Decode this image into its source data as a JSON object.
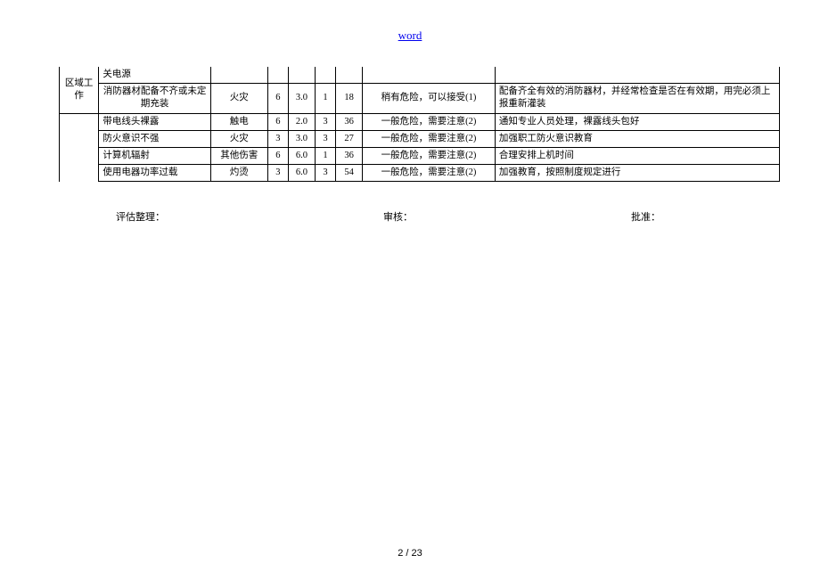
{
  "header": {
    "link": "word"
  },
  "table": {
    "side_col": "",
    "area": {
      "line1": "区域工",
      "line2": "作"
    },
    "prev_tail": "关电源",
    "rows": [
      {
        "hazard": "消防器材配备不齐或未定期充装",
        "type": "火灾",
        "v1": "6",
        "v2": "3.0",
        "v3": "1",
        "v4": "18",
        "risk": "稍有危险，可以接受(1)",
        "measure": "配备齐全有效的消防器材，并经常检查是否在有效期，用完必须上报重新灌装"
      },
      {
        "hazard": "带电线头裸露",
        "type": "触电",
        "v1": "6",
        "v2": "2.0",
        "v3": "3",
        "v4": "36",
        "risk": "一般危险，需要注意(2)",
        "measure": "通知专业人员处理，裸露线头包好"
      },
      {
        "hazard": "防火意识不强",
        "type": "火灾",
        "v1": "3",
        "v2": "3.0",
        "v3": "3",
        "v4": "27",
        "risk": "一般危险，需要注意(2)",
        "measure": "加强职工防火意识教育"
      },
      {
        "hazard": "计算机辐射",
        "type": "其他伤害",
        "v1": "6",
        "v2": "6.0",
        "v3": "1",
        "v4": "36",
        "risk": "一般危险，需要注意(2)",
        "measure": "合理安排上机时间"
      },
      {
        "hazard": "使用电器功率过载",
        "type": "灼烫",
        "v1": "3",
        "v2": "6.0",
        "v3": "3",
        "v4": "54",
        "risk": "一般危险，需要注意(2)",
        "measure": "加强教育，按照制度规定进行"
      }
    ]
  },
  "signoff": {
    "s1": "评估整理：",
    "s2": "审核：",
    "s3": "批准："
  },
  "pager": "2 / 23"
}
